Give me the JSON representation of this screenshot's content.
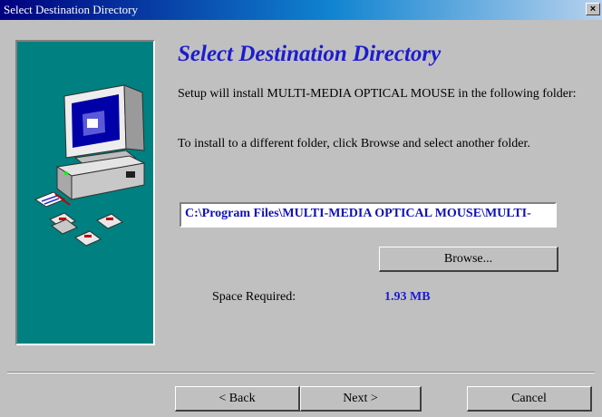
{
  "window": {
    "title": "Select Destination Directory",
    "close_glyph": "×"
  },
  "heading": "Select Destination Directory",
  "intro": "Setup will install MULTI-MEDIA OPTICAL MOUSE in the following folder:",
  "instruction": "To install to a different folder, click Browse and select another folder.",
  "destination": {
    "path": "C:\\Program Files\\MULTI-MEDIA OPTICAL MOUSE\\MULTI-"
  },
  "browse": {
    "label": "Browse..."
  },
  "space": {
    "label": "Space Required:",
    "value": "1.93 MB"
  },
  "buttons": {
    "back": "< Back",
    "next": "Next >",
    "cancel": "Cancel"
  },
  "illustration": {
    "icon": "computer-with-disks-icon",
    "panel_color": "#008080"
  },
  "colors": {
    "heading": "#1c1cd0",
    "path_text": "#1010b8",
    "title_bar": "#000080"
  }
}
